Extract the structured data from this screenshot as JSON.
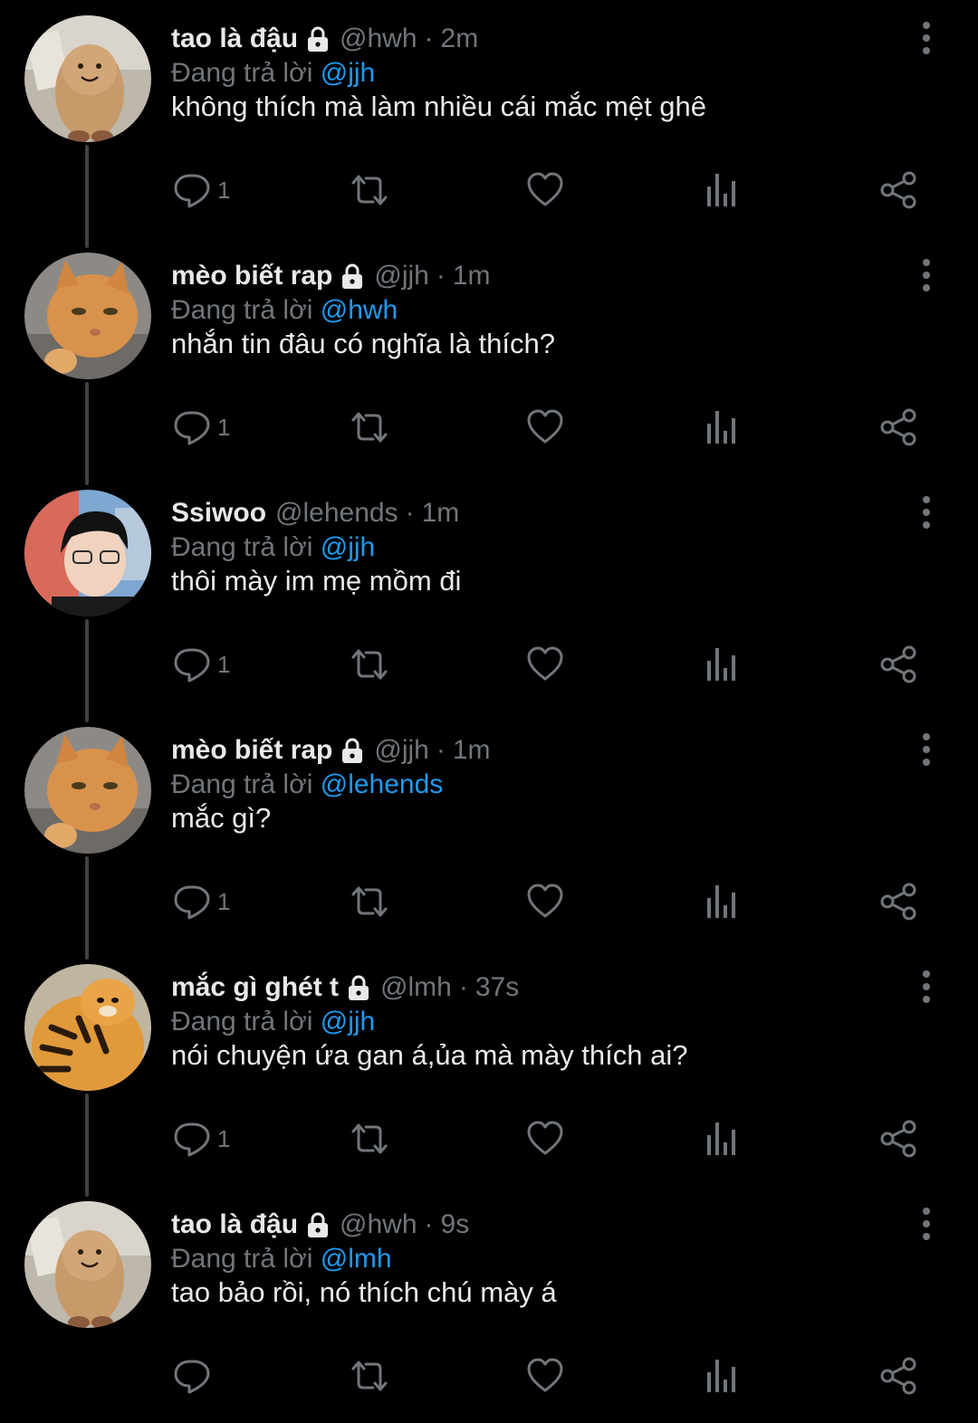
{
  "tweets": [
    {
      "name": "tao là đậu",
      "locked": true,
      "handle": "@hwh",
      "dot": "·",
      "time": "2m",
      "reply_prefix": "Đang trả lời",
      "reply_to": "@jjh",
      "text": "không thích mà làm nhiều cái mắc mệt ghê",
      "reply_count": "1",
      "avatar": "peanut-plush-avatar"
    },
    {
      "name": "mèo biết rap",
      "locked": true,
      "handle": "@jjh",
      "dot": "·",
      "time": "1m",
      "reply_prefix": "Đang trả lời",
      "reply_to": "@hwh",
      "text": "nhắn tin đâu có nghĩa là thích?",
      "reply_count": "1",
      "avatar": "orange-cat-avatar"
    },
    {
      "name": "Ssiwoo",
      "locked": false,
      "handle": "@lehends",
      "dot": "·",
      "time": "1m",
      "reply_prefix": "Đang trả lời",
      "reply_to": "@jjh",
      "text": "thôi mày im mẹ mồm đi",
      "reply_count": "1",
      "avatar": "person-glasses-avatar"
    },
    {
      "name": "mèo biết rap",
      "locked": true,
      "handle": "@jjh",
      "dot": "·",
      "time": "1m",
      "reply_prefix": "Đang trả lời",
      "reply_to": "@lehends",
      "text": "mắc gì?",
      "reply_count": "1",
      "avatar": "orange-cat-avatar"
    },
    {
      "name": "mắc gì ghét t",
      "locked": true,
      "handle": "@lmh",
      "dot": "·",
      "time": "37s",
      "reply_prefix": "Đang trả lời",
      "reply_to": "@jjh",
      "text": "nói chuyện ứa gan á,ủa mà mày thích ai?",
      "reply_count": "1",
      "avatar": "tiger-plush-avatar"
    },
    {
      "name": "tao là đậu",
      "locked": true,
      "handle": "@hwh",
      "dot": "·",
      "time": "9s",
      "reply_prefix": "Đang trả lời",
      "reply_to": "@lmh",
      "text": "tao bảo rồi, nó thích chú mày á",
      "reply_count": "",
      "avatar": "peanut-plush-avatar"
    }
  ],
  "icons": {
    "reply": "reply-icon",
    "retweet": "retweet-icon",
    "like": "like-icon",
    "views": "views-icon",
    "share": "share-icon",
    "more": "more-icon",
    "lock": "lock-icon"
  },
  "colors": {
    "background": "#000000",
    "text": "#e7e9ea",
    "muted": "#71767b",
    "link": "#1d9bf0",
    "thread_line": "#3e4144"
  }
}
